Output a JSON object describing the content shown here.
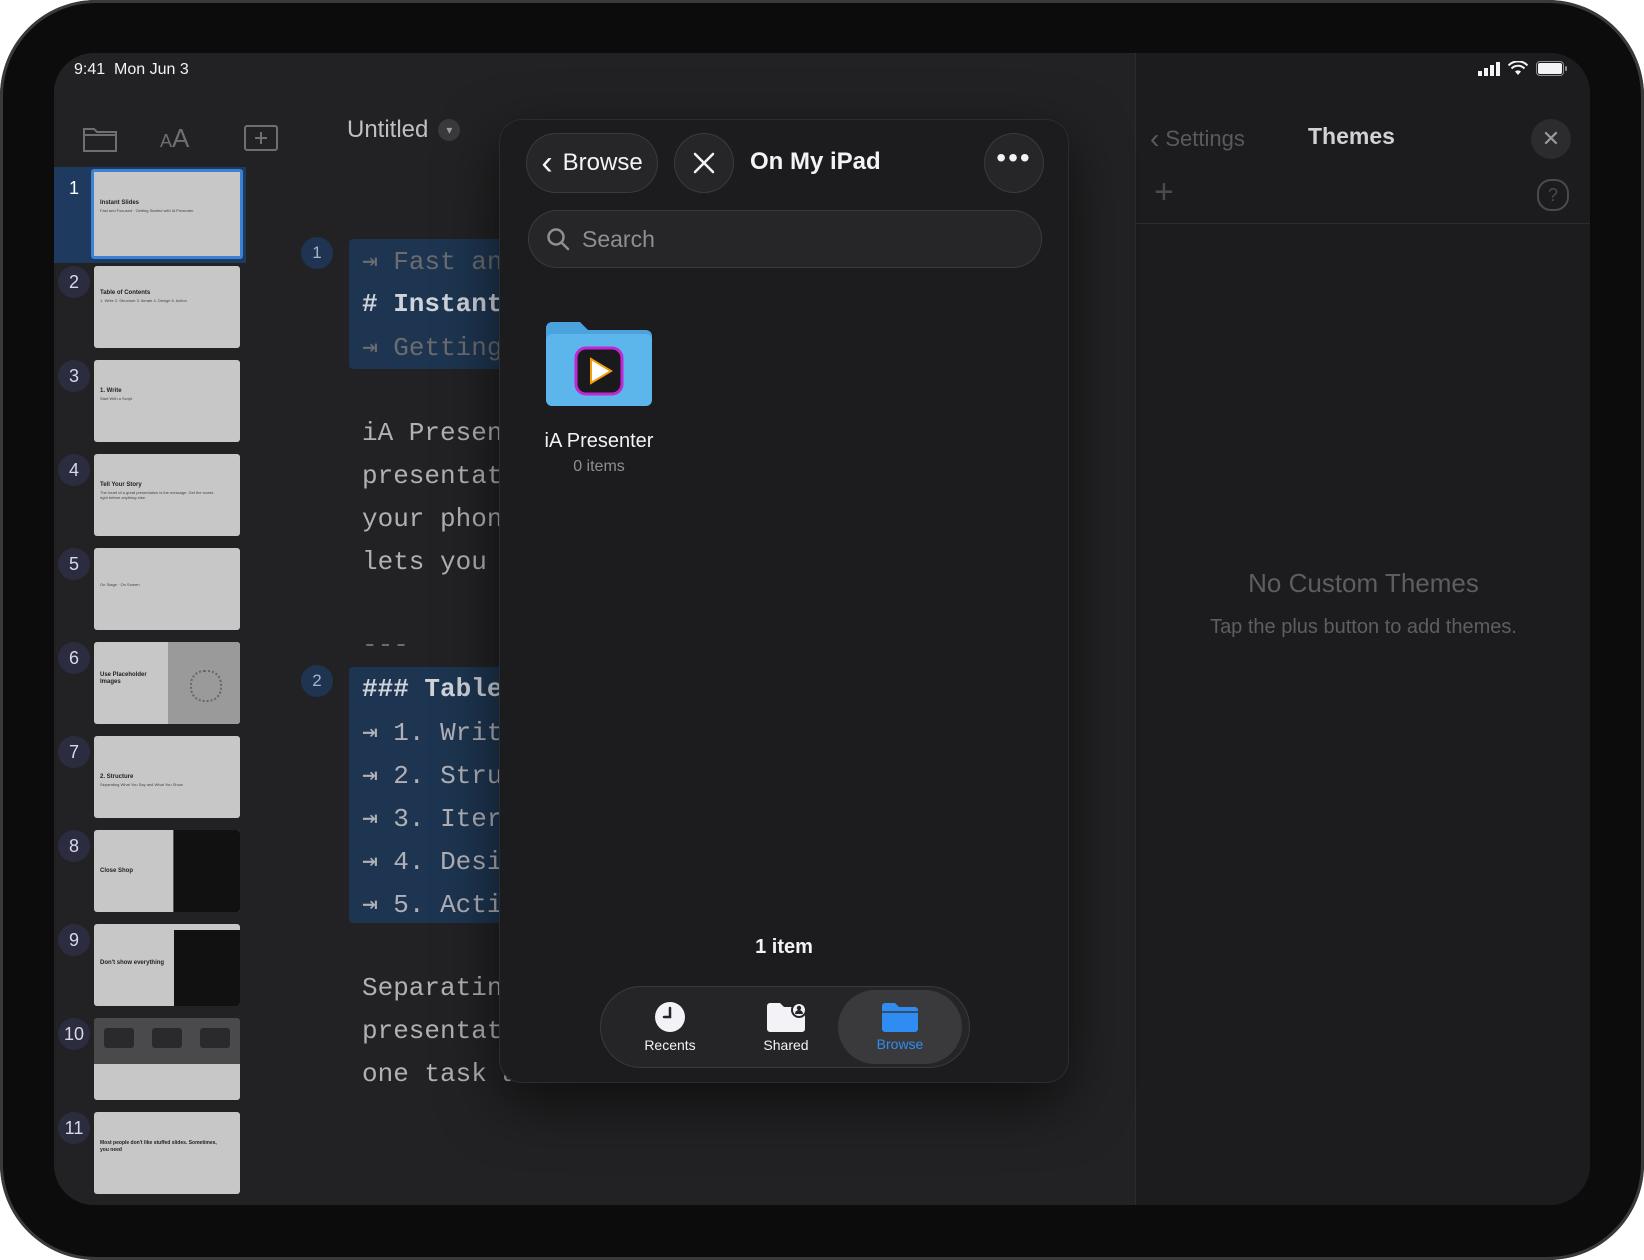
{
  "status_bar": {
    "time": "9:41",
    "date": "Mon Jun 3"
  },
  "editor": {
    "title": "Untitled",
    "toolbar_icons": [
      "folder-icon",
      "text-size-icon",
      "add-slide-icon"
    ],
    "slides": [
      {
        "num": "1",
        "title": "Instant Slides",
        "body": "Fast and Focused · Getting Started with iA Presenter"
      },
      {
        "num": "2",
        "title": "Table of Contents",
        "body": "1. Write 2. Structure 3. Iterate 4. Design 5. Action"
      },
      {
        "num": "3",
        "title": "1. Write",
        "body": "Start With a Script"
      },
      {
        "num": "4",
        "title": "Tell Your Story",
        "body": "The heart of a great presentation is the message. Get the words right before anything else."
      },
      {
        "num": "5",
        "title": "",
        "body": "On Stage · On Screen"
      },
      {
        "num": "6",
        "title": "Use Placeholder Images",
        "body": ""
      },
      {
        "num": "7",
        "title": "2. Structure",
        "body": "Separating What You Say and What You Show"
      },
      {
        "num": "8",
        "title": "Close Shop",
        "body": ""
      },
      {
        "num": "9",
        "title": "Don't show everything",
        "body": ""
      },
      {
        "num": "10",
        "title": "",
        "body": ""
      },
      {
        "num": "11",
        "title": "Most people don't like stuffed slides. Sometimes, you need",
        "body": ""
      }
    ],
    "code_lines": {
      "l1": "⇥ Fast an",
      "l2": "# Instant",
      "l3": "⇥ Getting",
      "p1": "iA Presen",
      "p2": "presentat",
      "p3": "your phon",
      "p4": "lets you",
      "sep": "---",
      "t0": "### Table",
      "t1": "⇥ 1. Writ",
      "t2": "⇥ 2. Stru",
      "t3": "⇥ 3. Iter",
      "t4": "⇥ 4. Desi",
      "t5": "⇥ 5. Acti",
      "q1": "Separatin",
      "q2": "presentat",
      "q3": "one task a"
    },
    "slide_markers": [
      "1",
      "2"
    ]
  },
  "themes_panel": {
    "back_label": "Settings",
    "title": "Themes",
    "empty_title": "No Custom Themes",
    "empty_subtitle": "Tap the plus button to add themes."
  },
  "file_picker": {
    "back_label": "Browse",
    "location_title": "On My iPad",
    "search_placeholder": "Search",
    "folder": {
      "name": "iA  Presenter",
      "count": "0 items"
    },
    "item_count": "1 item",
    "tabs": [
      {
        "label": "Recents",
        "icon": "clock-icon",
        "active": false
      },
      {
        "label": "Shared",
        "icon": "shared-folder-icon",
        "active": false
      },
      {
        "label": "Browse",
        "icon": "folder-icon",
        "active": true
      }
    ],
    "accent_color": "#2f8cf2"
  }
}
